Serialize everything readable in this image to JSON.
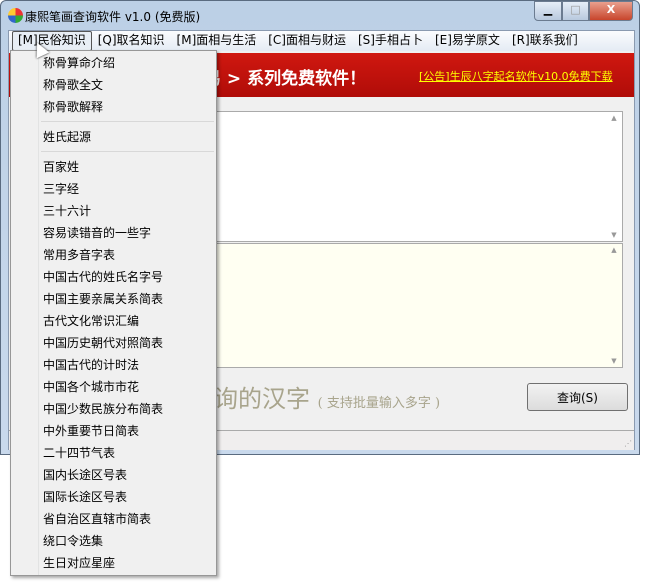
{
  "window": {
    "title": "康熙笔画查询软件 v1.0 (免费版)",
    "minimize": "▁",
    "maximize": "□",
    "close": "X"
  },
  "menubar": [
    "[M]民俗知识",
    "[Q]取名知识",
    "[M]面相与生活",
    "[C]面相与财运",
    "[S]手相占卜",
    "[E]易学原文",
    "[R]联系我们"
  ],
  "banner": {
    "text": "易 > 系列免费软件！",
    "link": "[公告]生辰八字起名软件v10.0免费下载"
  },
  "watermark": {
    "main": "询的汉字",
    "hint": "( 支持批量输入多字 )"
  },
  "query_button": "查询(S)",
  "dropdown": {
    "group1": [
      "称骨算命介绍",
      "称骨歌全文",
      "称骨歌解释"
    ],
    "group2": [
      "姓氏起源"
    ],
    "group3": [
      "百家姓",
      "三字经",
      "三十六计",
      "容易读错音的一些字",
      "常用多音字表",
      "中国古代的姓氏名字号",
      "中国主要亲属关系简表",
      "古代文化常识汇编",
      "中国历史朝代对照简表",
      "中国古代的计时法",
      "中国各个城市市花",
      "中国少数民族分布简表",
      "中外重要节日简表",
      "二十四节气表",
      "国内长途区号表",
      "国际长途区号表",
      "省自治区直辖市简表",
      "绕口令选集",
      "生日对应星座"
    ]
  }
}
